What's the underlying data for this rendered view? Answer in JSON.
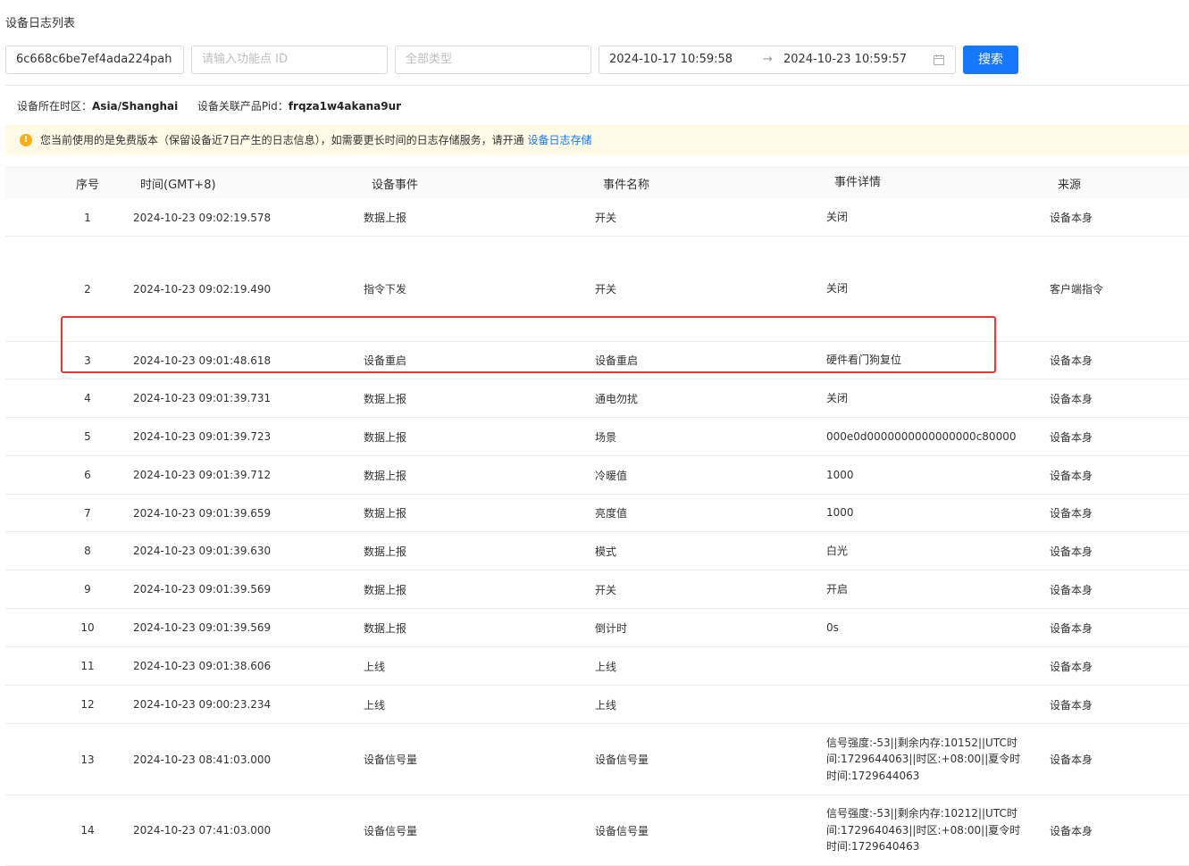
{
  "page": {
    "title": "设备日志列表"
  },
  "filters": {
    "device_id": "6c668c6be7ef4ada224pah",
    "function_point_placeholder": "请输入功能点 ID",
    "type_placeholder": "全部类型",
    "start_time": "2024-10-17  10:59:58",
    "end_time": "2024-10-23  10:59:57",
    "range_separator": "→",
    "search_label": "搜索"
  },
  "info": {
    "timezone_label": "设备所在时区：",
    "timezone_value": "Asia/Shanghai",
    "pid_label": "设备关联产品Pid：",
    "pid_value": "frqza1w4akana9ur"
  },
  "notice": {
    "text": "您当前使用的是免费版本（保留设备近7日产生的日志信息），如需要更长时间的日志存储服务，请开通",
    "link": "设备日志存储"
  },
  "table": {
    "headers": [
      "序号",
      "时间(GMT+8)",
      "设备事件",
      "事件名称",
      "事件详情",
      "来源"
    ],
    "rows": [
      {
        "no": "1",
        "time": "2024-10-23 09:02:19.578",
        "event": "数据上报",
        "name": "开关",
        "detail": "关闭",
        "source": "设备本身"
      },
      {
        "no": "2",
        "time": "2024-10-23 09:02:19.490",
        "event": "指令下发",
        "name": "开关",
        "detail": "关闭",
        "source": "客户端指令"
      },
      {
        "no": "3",
        "time": "2024-10-23 09:01:48.618",
        "event": "设备重启",
        "name": "设备重启",
        "detail": "硬件看门狗复位",
        "source": "设备本身"
      },
      {
        "no": "4",
        "time": "2024-10-23 09:01:39.731",
        "event": "数据上报",
        "name": "通电勿扰",
        "detail": "关闭",
        "source": "设备本身"
      },
      {
        "no": "5",
        "time": "2024-10-23 09:01:39.723",
        "event": "数据上报",
        "name": "场景",
        "detail": "000e0d0000000000000000c80000",
        "source": "设备本身"
      },
      {
        "no": "6",
        "time": "2024-10-23 09:01:39.712",
        "event": "数据上报",
        "name": "冷暖值",
        "detail": "1000",
        "source": "设备本身"
      },
      {
        "no": "7",
        "time": "2024-10-23 09:01:39.659",
        "event": "数据上报",
        "name": "亮度值",
        "detail": "1000",
        "source": "设备本身"
      },
      {
        "no": "8",
        "time": "2024-10-23 09:01:39.630",
        "event": "数据上报",
        "name": "模式",
        "detail": "白光",
        "source": "设备本身"
      },
      {
        "no": "9",
        "time": "2024-10-23 09:01:39.569",
        "event": "数据上报",
        "name": "开关",
        "detail": "开启",
        "source": "设备本身"
      },
      {
        "no": "10",
        "time": "2024-10-23 09:01:39.569",
        "event": "数据上报",
        "name": "倒计时",
        "detail": "0s",
        "source": "设备本身"
      },
      {
        "no": "11",
        "time": "2024-10-23 09:01:38.606",
        "event": "上线",
        "name": "上线",
        "detail": "",
        "source": "设备本身"
      },
      {
        "no": "12",
        "time": "2024-10-23 09:00:23.234",
        "event": "上线",
        "name": "上线",
        "detail": "",
        "source": "设备本身"
      },
      {
        "no": "13",
        "time": "2024-10-23 08:41:03.000",
        "event": "设备信号量",
        "name": "设备信号量",
        "detail": "信号强度:-53||剩余内存:10152||UTC时间:1729644063||时区:+08:00||夏令时时间:1729644063",
        "source": "设备本身"
      },
      {
        "no": "14",
        "time": "2024-10-23 07:41:03.000",
        "event": "设备信号量",
        "name": "设备信号量",
        "detail": "信号强度:-53||剩余内存:10212||UTC时间:1729640463||时区:+08:00||夏令时时间:1729640463",
        "source": "设备本身"
      }
    ]
  }
}
